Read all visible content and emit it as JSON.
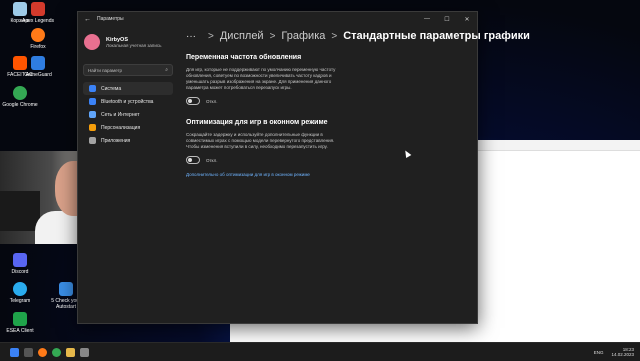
{
  "desktop_icons": [
    {
      "label": "Корзина",
      "color": "#9ecbe8"
    },
    {
      "label": "Apex Legends",
      "color": "#d33a2c"
    },
    {
      "label": "Firefox",
      "color": "#ff7a18"
    },
    {
      "label": "FACEIT AC",
      "color": "#ff5500"
    },
    {
      "label": "GameGuard",
      "color": "#2f7de1"
    },
    {
      "label": "Google Chrome",
      "color": "#34a853"
    },
    {
      "label": "Discord",
      "color": "#5865f2"
    },
    {
      "label": "Telegram",
      "color": "#2aabee"
    },
    {
      "label": "5 Check your Autostart",
      "color": "#3a8ee6"
    },
    {
      "label": "ESEA Client",
      "color": "#1fa34a"
    }
  ],
  "window": {
    "title": "Параметры",
    "back_icon": "←",
    "minimize": "—",
    "maximize": "☐",
    "close": "✕"
  },
  "profile": {
    "name": "KirbyOS",
    "account": "Локальная учетная запись"
  },
  "search": {
    "placeholder": "Найти параметр",
    "icon": "⌕"
  },
  "nav": [
    {
      "label": "Система",
      "color": "#3b82f6",
      "active": true
    },
    {
      "label": "Bluetooth и устройства",
      "color": "#3b82f6",
      "active": false
    },
    {
      "label": "Сеть и Интернет",
      "color": "#60a5fa",
      "active": false
    },
    {
      "label": "Персонализация",
      "color": "#f59e0b",
      "active": false
    },
    {
      "label": "Приложения",
      "color": "#a3a3a3",
      "active": false
    }
  ],
  "breadcrumb": {
    "dots": "···",
    "item1": "Дисплей",
    "item2": "Графика",
    "current": "Стандартные параметры графики",
    "sep": ">"
  },
  "vrr": {
    "title": "Переменная частота обновления",
    "description": "Для игр, которые не поддерживают по умолчанию переменную частоту обновления, советуем по возможности увеличивать частоту кадров и уменьшать разрыв изображения на экране. Для применения данного параметра может потребоваться перезапуск игры.",
    "state": "Откл."
  },
  "windowed": {
    "title": "Оптимизация для игр в оконном режиме",
    "description": "Сокращайте задержку и используйте дополнительные функции в совместимых играх с помощью модели перевернутого представления. Чтобы изменения вступили в силу, необходимо перезапустить игру.",
    "state": "Откл.",
    "link": "Дополнительно об оптимизации для игр в оконном режиме"
  },
  "tray": {
    "lang": "ENG",
    "time": "18:23",
    "date": "14.02.2023"
  }
}
